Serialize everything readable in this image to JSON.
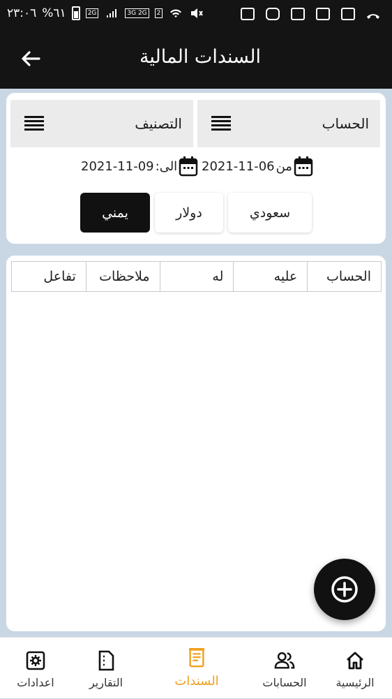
{
  "status_bar": {
    "time": "٢٣:٠٦",
    "battery": "%٦١",
    "network_2g": "2G",
    "network_3g_2g": "3G 2G",
    "sim_slot": "2"
  },
  "app_bar": {
    "title": "السندات المالية",
    "back_icon": "arrow-left-icon"
  },
  "filters": {
    "account_label": "الحساب",
    "classification_label": "التصنيف",
    "from_label": "من",
    "from_date": "2021-11-06",
    "to_label": ":الى",
    "to_date": "2021-11-09",
    "currencies": [
      "سعودي",
      "دولار",
      "يمني"
    ],
    "selected_currency": "يمني"
  },
  "table": {
    "columns": [
      "الحساب",
      "عليه",
      "له",
      "ملاحظات",
      "تفاعل"
    ],
    "rows": []
  },
  "fab": {
    "icon": "plus-circle-icon"
  },
  "bottom_nav": {
    "items": [
      {
        "label": "الرئيسية",
        "icon": "home-icon"
      },
      {
        "label": "الحسابات",
        "icon": "users-icon"
      },
      {
        "label": "السندات",
        "icon": "receipt-icon"
      },
      {
        "label": "التقارير",
        "icon": "report-icon"
      },
      {
        "label": "اعدادات",
        "icon": "settings-icon"
      }
    ],
    "active": "السندات"
  },
  "colors": {
    "app_bar": "#141414",
    "accent": "#f0a020",
    "background": "#c9d7e5",
    "selected_currency_bg": "#111111"
  }
}
